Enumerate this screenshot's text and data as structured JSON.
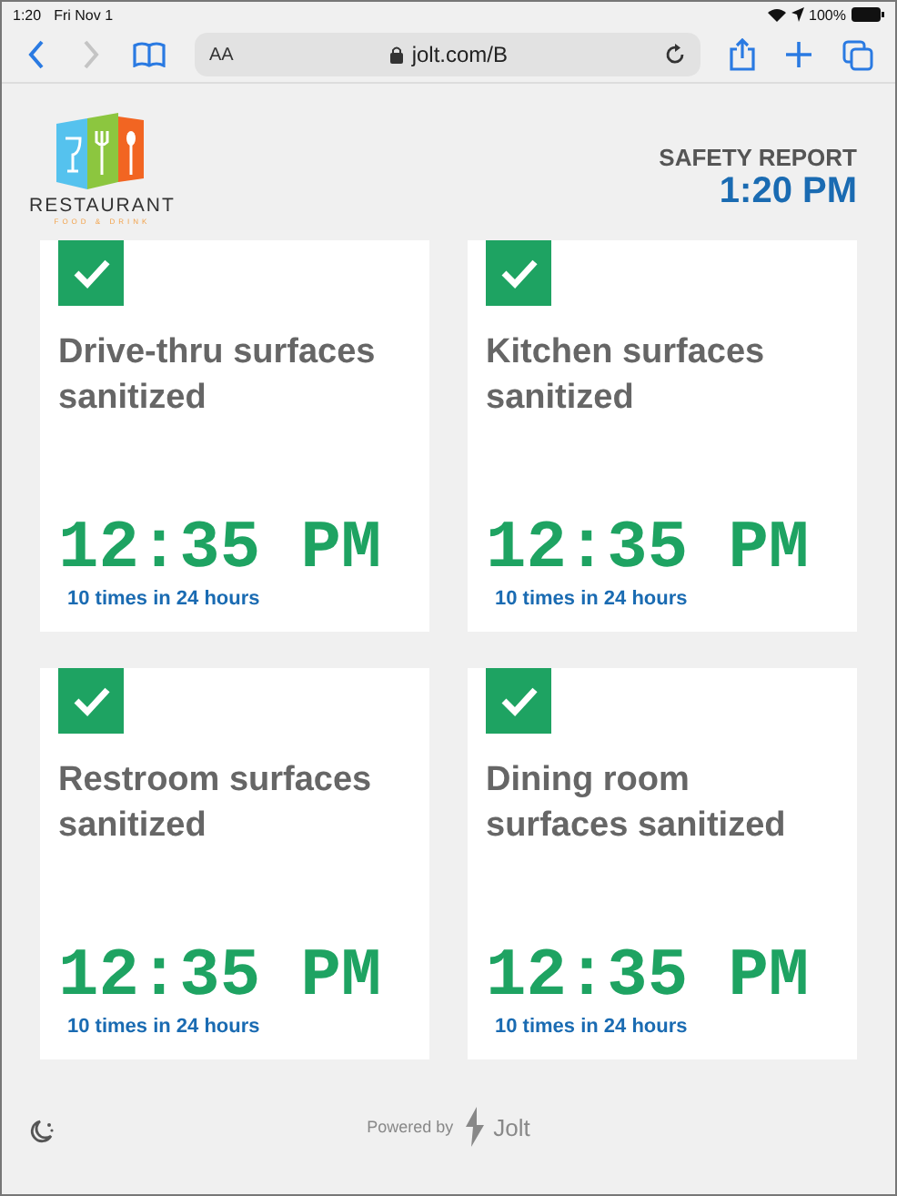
{
  "status_bar": {
    "time": "1:20",
    "date": "Fri Nov 1",
    "battery_text": "100%"
  },
  "browser": {
    "text_size_button": "AA",
    "url": "jolt.com/B"
  },
  "header": {
    "logo_name": "RESTAURANT",
    "logo_tagline": "FOOD & DRINK",
    "report_title": "SAFETY REPORT",
    "report_time": "1:20 PM"
  },
  "cards": [
    {
      "title": "Drive-thru surfaces sanitized",
      "checked": true,
      "time": "12:35 PM",
      "frequency": "10 times in 24 hours"
    },
    {
      "title": "Kitchen surfaces sanitized",
      "checked": true,
      "time": "12:35 PM",
      "frequency": "10 times in 24 hours"
    },
    {
      "title": "Restroom surfaces sanitized",
      "checked": true,
      "time": "12:35 PM",
      "frequency": "10 times in 24 hours"
    },
    {
      "title": "Dining room surfaces sanitized",
      "checked": true,
      "time": "12:35 PM",
      "frequency": "10 times in 24 hours"
    }
  ],
  "footer": {
    "powered_by": "Powered by",
    "brand": "Jolt"
  }
}
